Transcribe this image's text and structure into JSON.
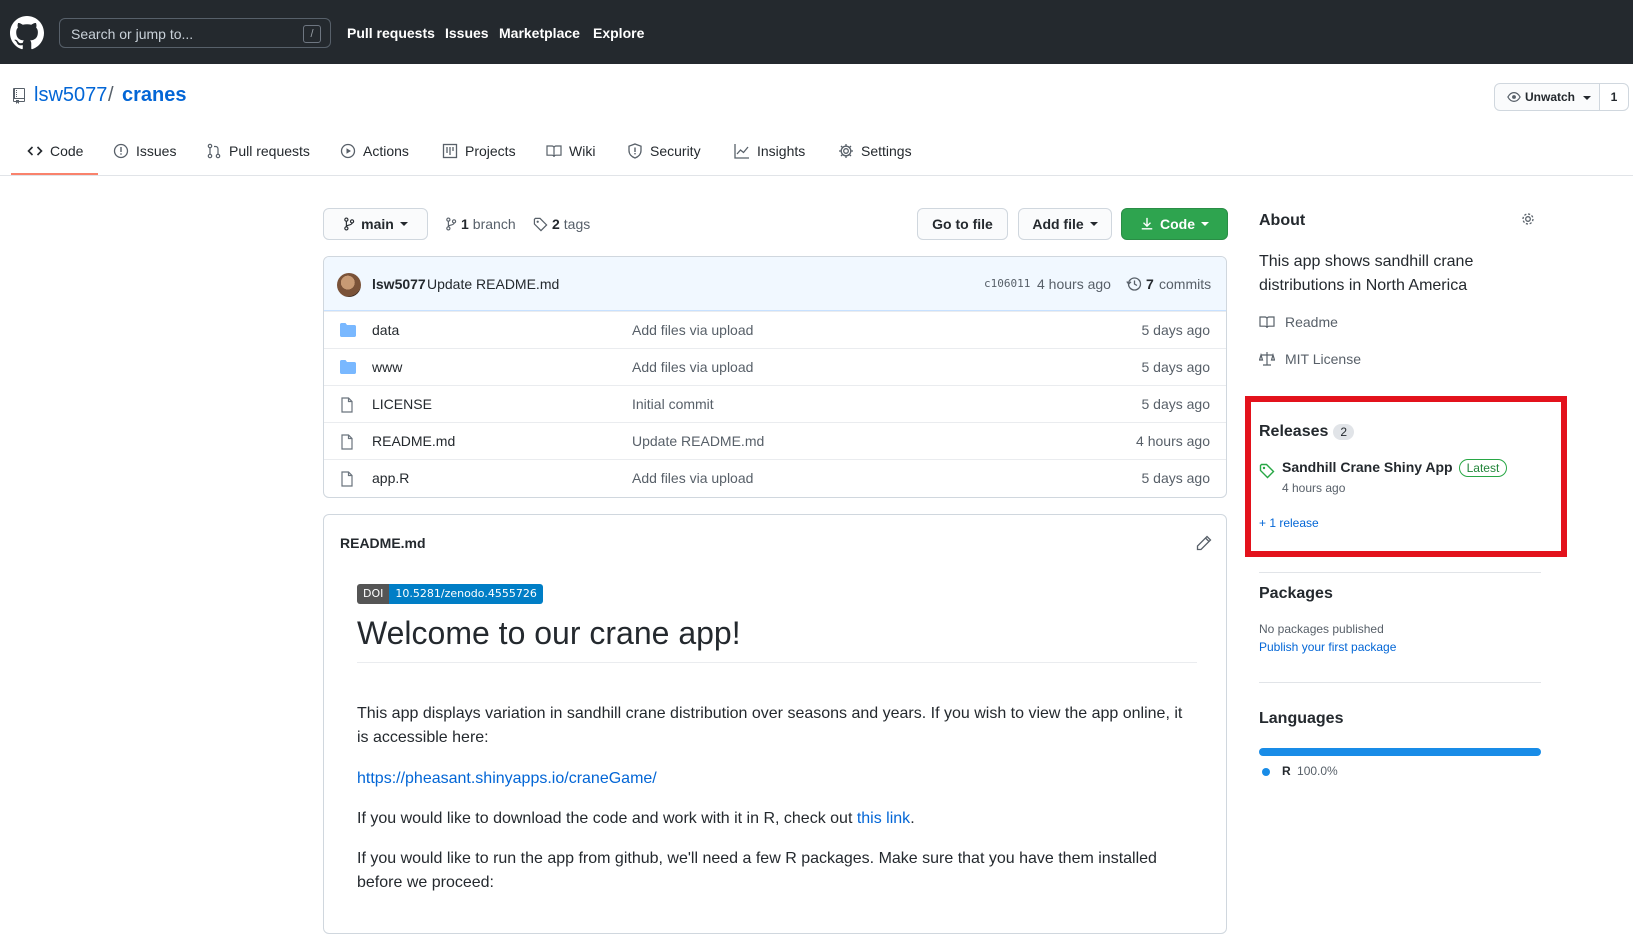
{
  "header": {
    "search_placeholder": "Search or jump to...",
    "search_shortcut": "/",
    "nav": [
      "Pull requests",
      "Issues",
      "Marketplace",
      "Explore"
    ]
  },
  "repo": {
    "owner": "lsw5077",
    "separator": "/",
    "name": "cranes",
    "watch_label": "Unwatch",
    "watch_count": "1"
  },
  "tabs": [
    "Code",
    "Issues",
    "Pull requests",
    "Actions",
    "Projects",
    "Wiki",
    "Security",
    "Insights",
    "Settings"
  ],
  "toolbar": {
    "branch": "main",
    "branch_count": "1",
    "branch_word": "branch",
    "tag_count": "2",
    "tag_word": "tags",
    "go_to_file": "Go to file",
    "add_file": "Add file",
    "code": "Code"
  },
  "commit": {
    "author": "lsw5077",
    "message": "Update README.md",
    "sha": "c106011",
    "time": "4 hours ago",
    "commit_count": "7",
    "commit_word": "commits"
  },
  "files": [
    {
      "type": "dir",
      "name": "data",
      "message": "Add files via upload",
      "age": "5 days ago"
    },
    {
      "type": "dir",
      "name": "www",
      "message": "Add files via upload",
      "age": "5 days ago"
    },
    {
      "type": "file",
      "name": "LICENSE",
      "message": "Initial commit",
      "age": "5 days ago"
    },
    {
      "type": "file",
      "name": "README.md",
      "message": "Update README.md",
      "age": "4 hours ago"
    },
    {
      "type": "file",
      "name": "app.R",
      "message": "Add files via upload",
      "age": "5 days ago"
    }
  ],
  "readme": {
    "title": "README.md",
    "badge_left": "DOI",
    "badge_right": "10.5281/zenodo.4555726",
    "heading": "Welcome to our crane app!",
    "p1": "This app displays variation in sandhill crane distribution over seasons and years. If you wish to view the app online, it is accessible here:",
    "link1": "https://pheasant.shinyapps.io/craneGame/",
    "p2_before": "If you would like to download the code and work with it in R, check out ",
    "p2_link": "this link",
    "p2_after": ".",
    "p3": "If you would like to run the app from github, we'll need a few R packages. Make sure that you have them installed before we proceed:"
  },
  "about": {
    "heading": "About",
    "description": "This app shows sandhill crane distributions in North America",
    "readme_link": "Readme",
    "license_link": "MIT License"
  },
  "releases": {
    "heading": "Releases",
    "count": "2",
    "latest_name": "Sandhill Crane Shiny App",
    "latest_badge": "Latest",
    "latest_time": "4 hours ago",
    "more": "+ 1 release",
    "highlight_color": "#e3121c"
  },
  "packages": {
    "heading": "Packages",
    "empty": "No packages published",
    "publish_link": "Publish your first package"
  },
  "languages": {
    "heading": "Languages",
    "items": [
      {
        "name": "R",
        "percent": "100.0%",
        "color": "#198ce7"
      }
    ]
  }
}
